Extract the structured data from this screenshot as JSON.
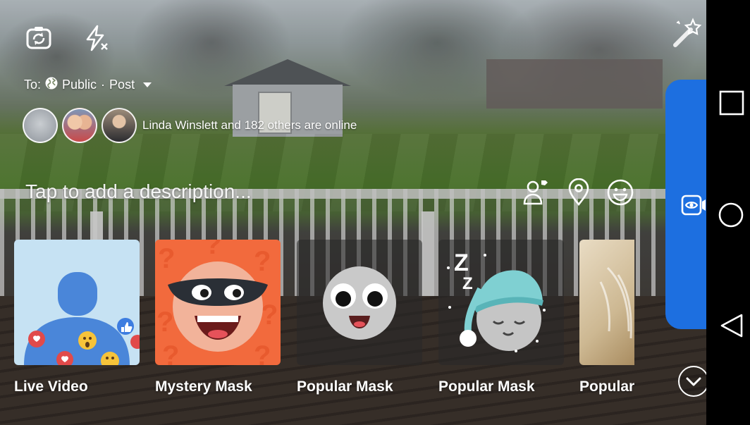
{
  "camera": {
    "flip_icon": "camera-flip-icon",
    "flash_icon": "flash-off-icon",
    "effects_icon": "magic-wand-icon"
  },
  "audience": {
    "to_label": "To:",
    "privacy": "Public",
    "separator": "·",
    "type": "Post"
  },
  "online": {
    "text": "Linda Winslett and 182 others are online"
  },
  "description": {
    "placeholder": "Tap to add a description..."
  },
  "effects": [
    {
      "label": "Live Video"
    },
    {
      "label": "Mystery Mask"
    },
    {
      "label": "Popular Mask"
    },
    {
      "label": "Popular Mask"
    },
    {
      "label": "Popular"
    }
  ],
  "colors": {
    "accent": "#1d6fe0",
    "mystery_bg": "#f26a3d",
    "live_bg": "#c6e2f3"
  }
}
